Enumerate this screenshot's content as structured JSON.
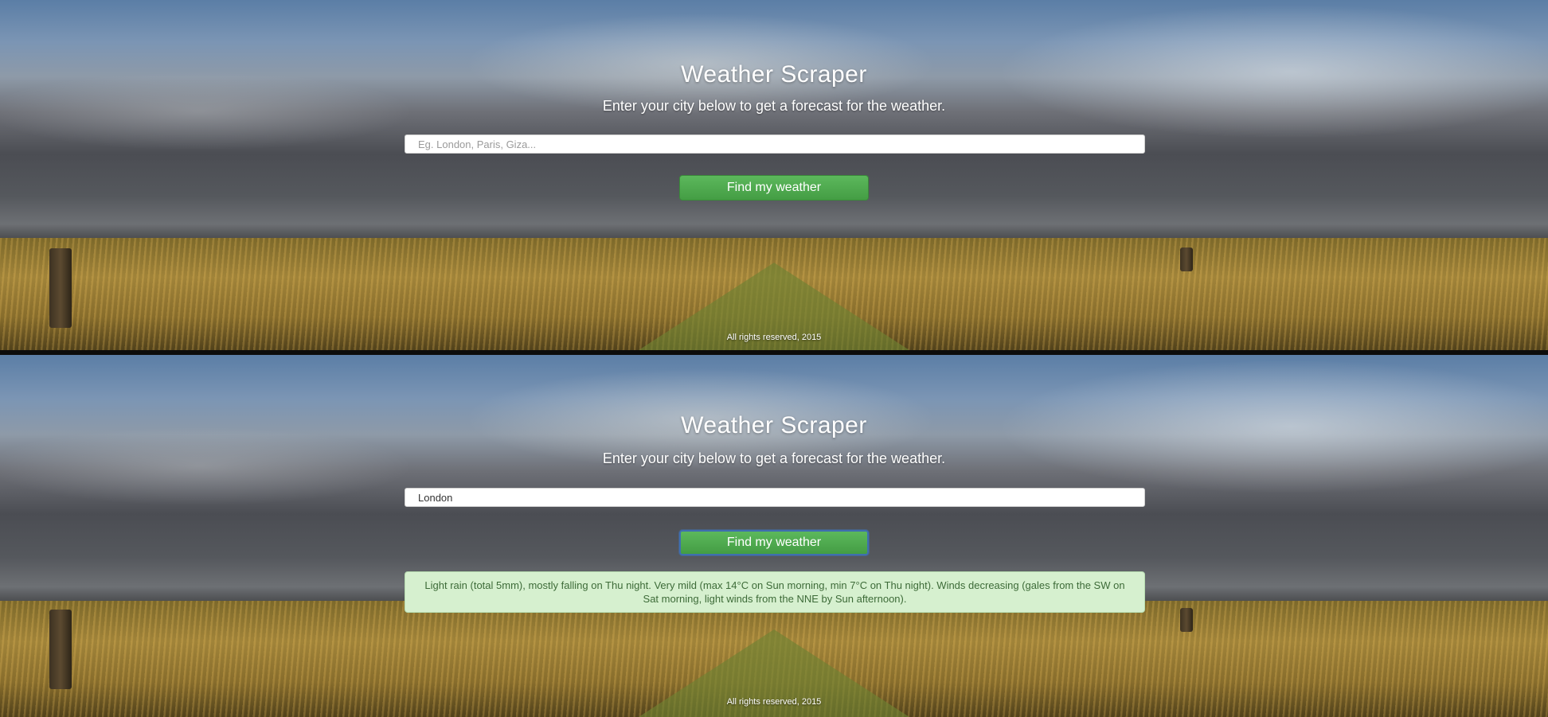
{
  "app": {
    "title": "Weather Scraper",
    "subtitle": "Enter your city below to get a forecast for the weather.",
    "footer": "All rights reserved, 2015"
  },
  "before": {
    "search": {
      "placeholder": "Eg. London, Paris, Giza...",
      "value": ""
    },
    "button_label": "Find my weather"
  },
  "after": {
    "search": {
      "placeholder": "Eg. London, Paris, Giza...",
      "value": "London"
    },
    "button_label": "Find my weather",
    "forecast": "Light rain (total 5mm), mostly falling on Thu night. Very mild (max 14°C on Sun morning, min 7°C on Thu night). Winds decreasing (gales from the SW on Sat morning, light winds from the NNE by Sun afternoon)."
  },
  "colors": {
    "button": "#5cb85c",
    "alert_background": "#d6f0cf",
    "alert_text": "#3d6b38"
  }
}
